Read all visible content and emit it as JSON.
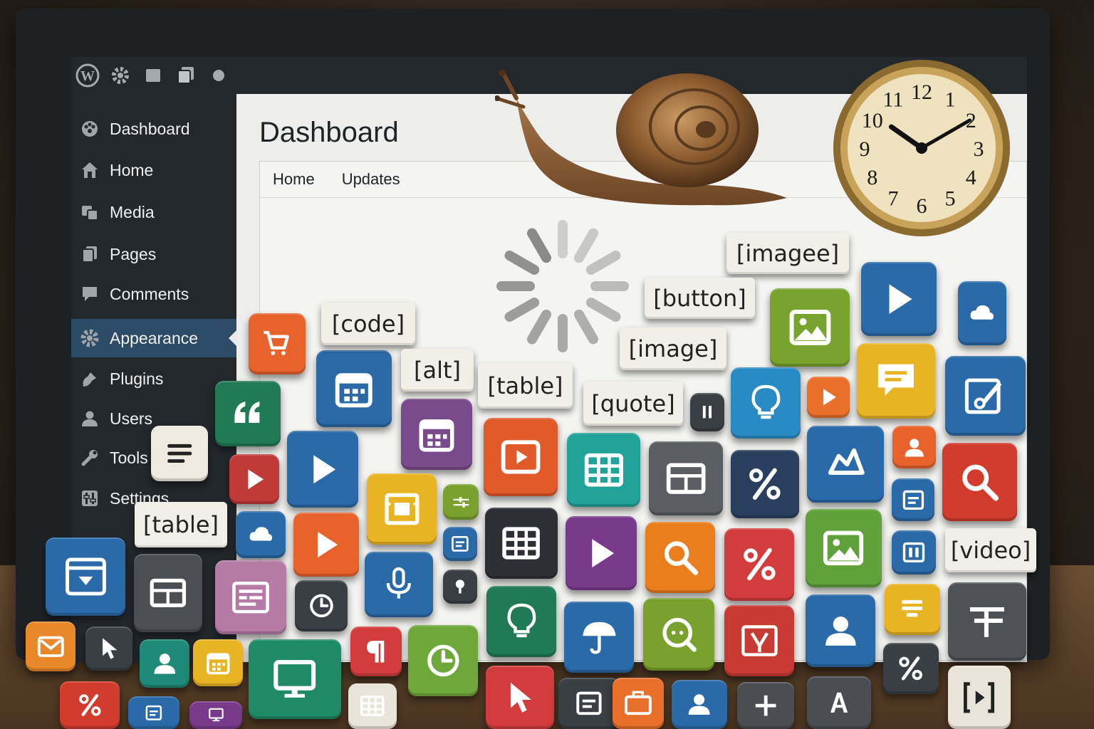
{
  "adminbar": {
    "icons": [
      "wordpress-logo-icon",
      "gear-icon",
      "page-icon",
      "pages-icon",
      "dot-icon"
    ]
  },
  "sidebar": {
    "items": [
      {
        "label": "Dashboard",
        "icon": "dashboard-icon"
      },
      {
        "label": "Home",
        "icon": "home-icon"
      },
      {
        "label": "Media",
        "icon": "media-icon"
      },
      {
        "label": "Pages",
        "icon": "pages-icon"
      },
      {
        "label": "Comments",
        "icon": "comments-icon"
      },
      {
        "label": "Appearance",
        "icon": "appearance-icon",
        "active": true
      },
      {
        "label": "Plugins",
        "icon": "plugins-icon"
      },
      {
        "label": "Users",
        "icon": "users-icon"
      },
      {
        "label": "Tools",
        "icon": "tools-icon"
      },
      {
        "label": "Settings",
        "icon": "settings-icon"
      }
    ]
  },
  "main": {
    "title": "Dashboard",
    "tabs": [
      "Home",
      "Updates"
    ],
    "status": "loading"
  },
  "chips": [
    "[imagee]",
    "[button]",
    "[image]",
    "[code]",
    "[alt]",
    "[table]",
    "[quote]",
    "[table]",
    "[video]"
  ],
  "tiles": [
    {
      "icon": "cart-icon",
      "color": "#e8622c"
    },
    {
      "icon": "calendar-icon",
      "color": "#2b6aa6"
    },
    {
      "icon": "calendar-icon",
      "color": "#7a4b8c"
    },
    {
      "icon": "quote-icon",
      "color": "#1f7a55"
    },
    {
      "icon": "list-icon",
      "color": "#efeae0"
    },
    {
      "icon": "play-icon",
      "color": "#c03a36"
    },
    {
      "icon": "play-icon",
      "color": "#2a6aa8"
    },
    {
      "icon": "video-icon",
      "color": "#e05a2a"
    },
    {
      "icon": "table-icon",
      "color": "#21a39a"
    },
    {
      "icon": "layout-icon",
      "color": "#5a5d61"
    },
    {
      "icon": "percent-icon",
      "color": "#2a3f5e"
    },
    {
      "icon": "cloud-icon",
      "color": "#2a6aa8"
    },
    {
      "icon": "image-icon",
      "color": "#78a32e"
    },
    {
      "icon": "play-icon",
      "color": "#2a6aa8"
    },
    {
      "icon": "table-icon",
      "color": "#2c2f35"
    },
    {
      "icon": "lightbulb-icon",
      "color": "#2a8ac4"
    },
    {
      "icon": "play-icon",
      "color": "#e8702a"
    },
    {
      "icon": "comment-icon",
      "color": "#e9b423"
    },
    {
      "icon": "edit-icon",
      "color": "#2a6aa8"
    },
    {
      "icon": "user-icon",
      "color": "#e8622c"
    },
    {
      "icon": "search-icon",
      "color": "#d23c2c"
    },
    {
      "icon": "shape-icon",
      "color": "#2a6aa8"
    },
    {
      "icon": "film-icon",
      "color": "#e9b423"
    },
    {
      "icon": "slider-icon",
      "color": "#7aa02e"
    },
    {
      "icon": "play-icon",
      "color": "#e8622c"
    },
    {
      "icon": "play-icon",
      "color": "#7a3a8c"
    },
    {
      "icon": "search-icon",
      "color": "#ea7d1e"
    },
    {
      "icon": "percent-icon",
      "color": "#d23c3c"
    },
    {
      "icon": "image-icon",
      "color": "#5fa13a"
    },
    {
      "icon": "doc-icon",
      "color": "#2a6aa8"
    },
    {
      "icon": "columns-icon",
      "color": "#2a6aa8"
    },
    {
      "icon": "browser-icon",
      "color": "#2a6aa8"
    },
    {
      "icon": "layout-icon",
      "color": "#4b4e52"
    },
    {
      "icon": "form-icon",
      "color": "#b57aa5"
    },
    {
      "icon": "clock-icon",
      "color": "#3a3f45"
    },
    {
      "icon": "microphone-icon",
      "color": "#2a6aa8"
    },
    {
      "icon": "lightbulb-icon",
      "color": "#1f7a55"
    },
    {
      "icon": "umbrella-icon",
      "color": "#2a6aa8"
    },
    {
      "icon": "chat-icon",
      "color": "#7aa02e"
    },
    {
      "icon": "coupon-icon",
      "color": "#c83a34"
    },
    {
      "icon": "user-icon",
      "color": "#2a6aa8"
    },
    {
      "icon": "highlight-icon",
      "color": "#e9b423"
    },
    {
      "icon": "align-icon",
      "color": "#4e5257"
    },
    {
      "icon": "mail-icon",
      "color": "#e8882a"
    },
    {
      "icon": "cursor-icon",
      "color": "#3a3f45"
    },
    {
      "icon": "user-icon",
      "color": "#1f8a78"
    },
    {
      "icon": "calendar-icon",
      "color": "#e9b423"
    },
    {
      "icon": "monitor-icon",
      "color": "#1f8a66"
    },
    {
      "icon": "paragraph-icon",
      "color": "#d23c3c"
    },
    {
      "icon": "clock-icon",
      "color": "#6ea83a"
    },
    {
      "icon": "percent-icon",
      "color": "#d23c2c"
    },
    {
      "icon": "cursor-icon",
      "color": "#d23c3c"
    },
    {
      "icon": "doc-icon",
      "color": "#3a3f45"
    },
    {
      "icon": "briefcase-icon",
      "color": "#e8702a"
    },
    {
      "icon": "user-icon",
      "color": "#2a6aa8"
    },
    {
      "icon": "plus-icon",
      "color": "#4a4d52"
    },
    {
      "icon": "text-a-icon",
      "color": "#4a4d52"
    },
    {
      "icon": "percent-icon",
      "color": "#3a3f45"
    },
    {
      "icon": "bracket-play-icon",
      "color": "#e9e4da"
    },
    {
      "icon": "pause-icon",
      "color": "#3a3f45"
    },
    {
      "icon": "pin-icon",
      "color": "#3a3f45"
    },
    {
      "icon": "doc-icon",
      "color": "#2a6aa8"
    },
    {
      "icon": "doc-icon",
      "color": "#2a6aa8"
    },
    {
      "icon": "monitor-icon",
      "color": "#7a3a8c"
    },
    {
      "icon": "table-icon",
      "color": "#e9e4da"
    },
    {
      "icon": "cloud-icon",
      "color": "#2a6aa8"
    }
  ]
}
